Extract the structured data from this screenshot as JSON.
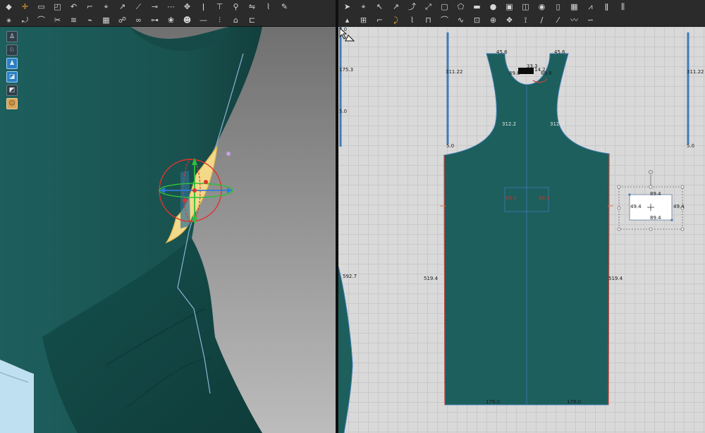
{
  "toolbar_left": {
    "row1": [
      {
        "icon": "move-down-icon",
        "glyph": "◆"
      },
      {
        "icon": "transform-icon",
        "glyph": "✛",
        "accent": true
      },
      {
        "icon": "select-box-icon",
        "glyph": "▭"
      },
      {
        "icon": "select-mesh-icon",
        "glyph": "◰"
      },
      {
        "icon": "fold-icon",
        "glyph": "↶"
      },
      {
        "icon": "tack-icon",
        "glyph": "⌐"
      },
      {
        "icon": "pin-icon",
        "glyph": "⌖"
      },
      {
        "icon": "seam-icon",
        "glyph": "↗"
      },
      {
        "icon": "measure-icon",
        "glyph": "⟋"
      },
      {
        "icon": "strap-icon",
        "glyph": "⊸"
      },
      {
        "icon": "sewing-icon",
        "glyph": "⋯"
      },
      {
        "icon": "avatar-pose-icon",
        "glyph": "✥"
      },
      {
        "icon": "style-line-icon",
        "glyph": "ǀ"
      },
      {
        "icon": "trim-icon",
        "glyph": "⊤"
      },
      {
        "icon": "button-icon",
        "glyph": "⚲"
      },
      {
        "icon": "mirror-icon",
        "glyph": "⇋"
      },
      {
        "icon": "steam-icon",
        "glyph": "⌇"
      },
      {
        "icon": "pencil-icon",
        "glyph": "✎"
      }
    ],
    "row2": [
      {
        "icon": "walk-icon",
        "glyph": "⚹"
      },
      {
        "icon": "rotate-piece-icon",
        "glyph": "⤾"
      },
      {
        "icon": "hang-icon",
        "glyph": "⌒"
      },
      {
        "icon": "scissors-icon",
        "glyph": "✂"
      },
      {
        "icon": "drape-icon",
        "glyph": "≋"
      },
      {
        "icon": "brush-icon",
        "glyph": "⌁"
      },
      {
        "icon": "fabric-icon",
        "glyph": "▦"
      },
      {
        "icon": "sample-icon",
        "glyph": "☍"
      },
      {
        "icon": "glasses-icon",
        "glyph": "∞"
      },
      {
        "icon": "link-icon",
        "glyph": "⊶"
      },
      {
        "icon": "flower-icon",
        "glyph": "❀"
      },
      {
        "icon": "avatar-head-icon",
        "glyph": "☻"
      },
      {
        "icon": "bar-icon",
        "glyph": "—"
      },
      {
        "icon": "zipper-icon",
        "glyph": "⫶"
      },
      {
        "icon": "bag-icon",
        "glyph": "⌂"
      },
      {
        "icon": "ruler-icon",
        "glyph": "⊏"
      }
    ]
  },
  "toolbar_right": {
    "row1": [
      {
        "icon": "select-piece-icon",
        "glyph": "➤"
      },
      {
        "icon": "edit-point-icon",
        "glyph": "⌖"
      },
      {
        "icon": "curve-point-icon",
        "glyph": "↖"
      },
      {
        "icon": "edit-curvature-icon",
        "glyph": "↗"
      },
      {
        "icon": "add-point-icon",
        "glyph": "⤴"
      },
      {
        "icon": "cut-icon",
        "glyph": "⤢"
      },
      {
        "icon": "rectangle-icon",
        "glyph": "▢"
      },
      {
        "icon": "polygon-icon",
        "glyph": "⬠"
      },
      {
        "icon": "fill-rect-icon",
        "glyph": "▬"
      },
      {
        "icon": "circle-icon",
        "glyph": "●"
      },
      {
        "icon": "image-icon",
        "glyph": "▣"
      },
      {
        "icon": "internal-rect-icon",
        "glyph": "◫"
      },
      {
        "icon": "internal-circle-icon",
        "glyph": "◉"
      },
      {
        "icon": "dart-icon",
        "glyph": "▯"
      },
      {
        "icon": "grid-icon",
        "glyph": "▦"
      },
      {
        "icon": "zigzag-icon",
        "glyph": "⩘"
      },
      {
        "icon": "lines-icon",
        "glyph": "ǁ"
      },
      {
        "icon": "pleat-icon",
        "glyph": "⫼"
      }
    ],
    "row2": [
      {
        "icon": "trace-icon",
        "glyph": "▴"
      },
      {
        "icon": "offset-icon",
        "glyph": "⊞"
      },
      {
        "icon": "notch-icon",
        "glyph": "⌐"
      },
      {
        "icon": "fold-arrange-icon",
        "glyph": "⤸",
        "accent": true
      },
      {
        "icon": "arrange-icon",
        "glyph": "⌇"
      },
      {
        "icon": "sync-icon",
        "glyph": "⊓"
      },
      {
        "icon": "segment-sew-icon",
        "glyph": "⌒"
      },
      {
        "icon": "free-sew-icon",
        "glyph": "∿"
      },
      {
        "icon": "check-sew-icon",
        "glyph": "⊡"
      },
      {
        "icon": "tack-on-avatar-icon",
        "glyph": "⊕"
      },
      {
        "icon": "knot-icon",
        "glyph": "❖"
      },
      {
        "icon": "pin-2d-icon",
        "glyph": "⟟"
      },
      {
        "icon": "diagonal-line-icon",
        "glyph": "∕"
      },
      {
        "icon": "diagonal-line-2-icon",
        "glyph": "⁄"
      },
      {
        "icon": "curve-line-icon",
        "glyph": "〰"
      },
      {
        "icon": "wave-icon",
        "glyph": "∽"
      }
    ]
  },
  "side_tools": [
    {
      "icon": "garment-icon",
      "glyph": "♙"
    },
    {
      "icon": "garment-outline-icon",
      "glyph": "♘"
    },
    {
      "icon": "avatar-view-icon",
      "glyph": "♟",
      "active": true
    },
    {
      "icon": "texture-icon",
      "glyph": "◪",
      "active": true
    },
    {
      "icon": "fabric-view-icon",
      "glyph": "◩"
    },
    {
      "icon": "avatar-face-icon",
      "glyph": "☺",
      "avatar": true
    }
  ],
  "colors": {
    "garment": "#1c5f5d",
    "garment_dark": "#154846",
    "selection_yellow": "#f3d98a",
    "seam_red": "#c8453a",
    "edge_blue": "#3f7bb5",
    "toolbar_bg": "#2b2b2b"
  },
  "pattern": {
    "measurements": {
      "left_bar_top": "5.0",
      "left_bar_len": "175.3",
      "left_bar_mid": "5.0",
      "side_left": "592.7",
      "bar2_label": "311.22",
      "bar2_bottom": "5.0",
      "shoulder_left": "45.6",
      "shoulder_right": "45.6",
      "neck_top": "33.3",
      "neck_left": "89.8",
      "neck_mid": "14.2",
      "neck_right": "89.8",
      "armhole_left": "312.2",
      "armhole_right": "312.2",
      "bar3_label": "311.22",
      "bar3_bottom": "5.0",
      "pocket_left": "89.4",
      "pocket_right": "89.4",
      "side_seam_left": "519.4",
      "side_seam_right": "519.4",
      "hem_left": "179.0",
      "hem_right": "179.0",
      "patch_top": "89.4",
      "patch_left": "49.4",
      "patch_right": "49.4",
      "patch_bottom": "89.4"
    }
  }
}
